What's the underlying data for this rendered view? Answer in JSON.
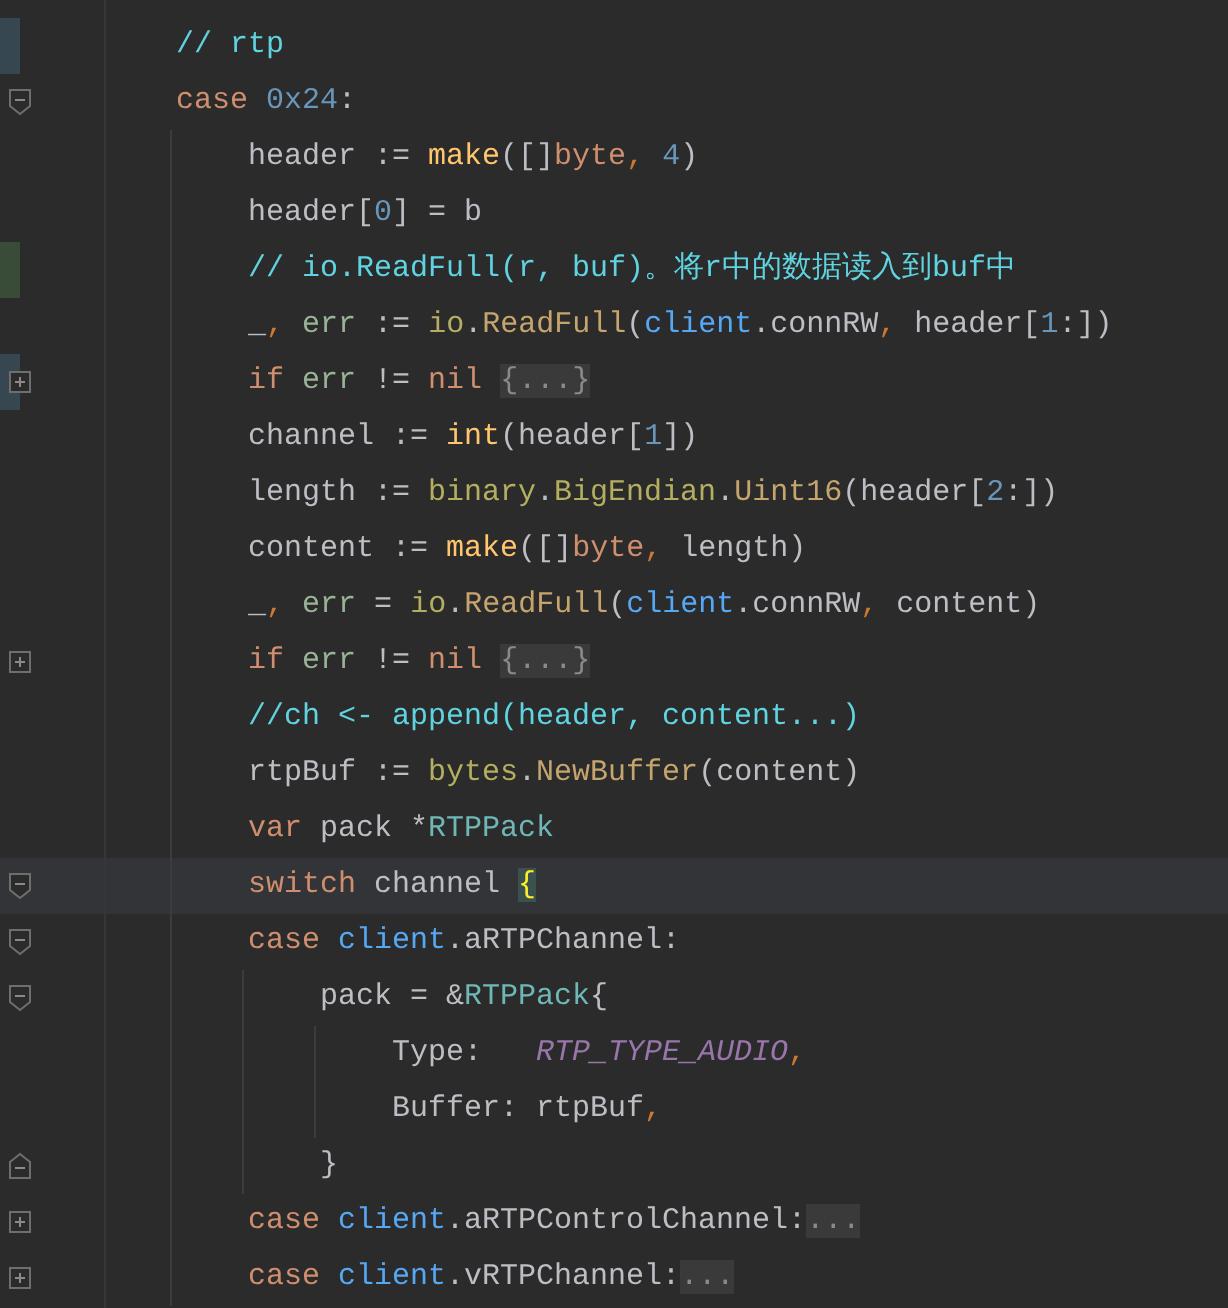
{
  "editor": {
    "lines": [
      {
        "color": "#374752",
        "kind": "plain",
        "current": false,
        "tokens": [
          {
            "text": "// rtp",
            "kind": "comment"
          }
        ]
      },
      {
        "kind": "fold_start",
        "current": false,
        "tokens": [
          {
            "text": "case ",
            "kind": "keyword"
          },
          {
            "text": "0x24",
            "kind": "number"
          },
          {
            "text": ":",
            "kind": "plain"
          }
        ],
        "children": [
          {
            "kind": "plain",
            "current": false,
            "tokens": [
              {
                "text": "header := ",
                "kind": "plain"
              },
              {
                "text": "make",
                "kind": "builtin"
              },
              {
                "text": "([]",
                "kind": "plain"
              },
              {
                "text": "byte",
                "kind": "keyword"
              },
              {
                "text": ", ",
                "kind": "punct"
              },
              {
                "text": "4",
                "kind": "number"
              },
              {
                "text": ")",
                "kind": "plain"
              }
            ]
          },
          {
            "kind": "plain",
            "current": false,
            "tokens": [
              {
                "text": "header[",
                "kind": "plain"
              },
              {
                "text": "0",
                "kind": "number"
              },
              {
                "text": "] = b",
                "kind": "plain"
              }
            ]
          },
          {
            "color": "#384c38",
            "kind": "plain",
            "current": false,
            "tokens": [
              {
                "text": "// io.ReadFull(r, buf)。将r中的数据读入到buf中",
                "kind": "comment"
              }
            ]
          },
          {
            "kind": "plain",
            "current": false,
            "tokens": [
              {
                "text": "_",
                "kind": "plain"
              },
              {
                "text": ", ",
                "kind": "punct"
              },
              {
                "text": "err",
                "kind": "local"
              },
              {
                "text": " := ",
                "kind": "plain"
              },
              {
                "text": "io",
                "kind": "package"
              },
              {
                "text": ".",
                "kind": "plain"
              },
              {
                "text": "ReadFull",
                "kind": "function"
              },
              {
                "text": "(",
                "kind": "plain"
              },
              {
                "text": "client",
                "kind": "field"
              },
              {
                "text": ".connRW",
                "kind": "plain"
              },
              {
                "text": ", ",
                "kind": "punct"
              },
              {
                "text": "header[",
                "kind": "plain"
              },
              {
                "text": "1",
                "kind": "number"
              },
              {
                "text": ":])",
                "kind": "plain"
              }
            ]
          },
          {
            "color": "#374752",
            "kind": "folded",
            "current": false,
            "tokens": [
              {
                "text": "if ",
                "kind": "keyword"
              },
              {
                "text": "err",
                "kind": "local"
              },
              {
                "text": " != ",
                "kind": "plain"
              },
              {
                "text": "nil ",
                "kind": "keyword"
              },
              {
                "text": "{...}",
                "kind": "folded"
              }
            ]
          },
          {
            "kind": "plain",
            "current": false,
            "tokens": [
              {
                "text": "channel := ",
                "kind": "plain"
              },
              {
                "text": "int",
                "kind": "builtin"
              },
              {
                "text": "(header[",
                "kind": "plain"
              },
              {
                "text": "1",
                "kind": "number"
              },
              {
                "text": "])",
                "kind": "plain"
              }
            ]
          },
          {
            "kind": "plain",
            "current": false,
            "tokens": [
              {
                "text": "length := ",
                "kind": "plain"
              },
              {
                "text": "binary",
                "kind": "package"
              },
              {
                "text": ".",
                "kind": "plain"
              },
              {
                "text": "BigEndian",
                "kind": "package"
              },
              {
                "text": ".",
                "kind": "plain"
              },
              {
                "text": "Uint16",
                "kind": "function"
              },
              {
                "text": "(header[",
                "kind": "plain"
              },
              {
                "text": "2",
                "kind": "number"
              },
              {
                "text": ":])",
                "kind": "plain"
              }
            ]
          },
          {
            "kind": "plain",
            "current": false,
            "tokens": [
              {
                "text": "content := ",
                "kind": "plain"
              },
              {
                "text": "make",
                "kind": "builtin"
              },
              {
                "text": "([]",
                "kind": "plain"
              },
              {
                "text": "byte",
                "kind": "keyword"
              },
              {
                "text": ", ",
                "kind": "punct"
              },
              {
                "text": "length)",
                "kind": "plain"
              }
            ]
          },
          {
            "kind": "plain",
            "current": false,
            "tokens": [
              {
                "text": "_",
                "kind": "plain"
              },
              {
                "text": ", ",
                "kind": "punct"
              },
              {
                "text": "err",
                "kind": "local"
              },
              {
                "text": " = ",
                "kind": "plain"
              },
              {
                "text": "io",
                "kind": "package"
              },
              {
                "text": ".",
                "kind": "plain"
              },
              {
                "text": "ReadFull",
                "kind": "function"
              },
              {
                "text": "(",
                "kind": "plain"
              },
              {
                "text": "client",
                "kind": "field"
              },
              {
                "text": ".connRW",
                "kind": "plain"
              },
              {
                "text": ", ",
                "kind": "punct"
              },
              {
                "text": "content)",
                "kind": "plain"
              }
            ]
          },
          {
            "kind": "folded",
            "current": false,
            "tokens": [
              {
                "text": "if ",
                "kind": "keyword"
              },
              {
                "text": "err",
                "kind": "local"
              },
              {
                "text": " != ",
                "kind": "plain"
              },
              {
                "text": "nil ",
                "kind": "keyword"
              },
              {
                "text": "{...}",
                "kind": "folded"
              }
            ]
          },
          {
            "kind": "plain",
            "current": false,
            "tokens": [
              {
                "text": "//ch <- append(header, content...)",
                "kind": "comment"
              }
            ]
          },
          {
            "kind": "plain",
            "current": false,
            "tokens": [
              {
                "text": "rtpBuf := ",
                "kind": "plain"
              },
              {
                "text": "bytes",
                "kind": "package"
              },
              {
                "text": ".",
                "kind": "plain"
              },
              {
                "text": "NewBuffer",
                "kind": "function"
              },
              {
                "text": "(content)",
                "kind": "plain"
              }
            ]
          },
          {
            "kind": "plain",
            "current": false,
            "tokens": [
              {
                "text": "var ",
                "kind": "keyword"
              },
              {
                "text": "pack *",
                "kind": "plain"
              },
              {
                "text": "RTPPack",
                "kind": "type"
              }
            ]
          },
          {
            "kind": "fold_start",
            "current": true,
            "tokens": [
              {
                "text": "switch ",
                "kind": "keyword"
              },
              {
                "text": "channel ",
                "kind": "plain"
              },
              {
                "text": "{",
                "kind": "brace_match"
              }
            ]
          },
          {
            "kind": "fold_start",
            "current": false,
            "tokens": [
              {
                "text": "case ",
                "kind": "keyword"
              },
              {
                "text": "client",
                "kind": "field"
              },
              {
                "text": ".aRTPChannel:",
                "kind": "plain"
              }
            ],
            "children": [
              {
                "kind": "fold_start",
                "current": false,
                "tokens": [
                  {
                    "text": "pack = &",
                    "kind": "plain"
                  },
                  {
                    "text": "RTPPack",
                    "kind": "type"
                  },
                  {
                    "text": "{",
                    "kind": "plain"
                  }
                ],
                "children": [
                  {
                    "current": false,
                    "tokens": [
                      {
                        "text": "Type:   ",
                        "kind": "plain"
                      },
                      {
                        "text": "RTP_TYPE_AUDIO",
                        "kind": "constant"
                      },
                      {
                        "text": ",",
                        "kind": "punct"
                      }
                    ]
                  },
                  {
                    "current": false,
                    "tokens": [
                      {
                        "text": "Buffer: rtpBuf",
                        "kind": "plain"
                      },
                      {
                        "text": ",",
                        "kind": "punct"
                      }
                    ]
                  }
                ]
              },
              {
                "kind": "fold_end",
                "current": false,
                "tokens": [
                  {
                    "text": "}",
                    "kind": "plain"
                  }
                ]
              }
            ]
          },
          {
            "kind": "folded",
            "current": false,
            "tokens": [
              {
                "text": "case ",
                "kind": "keyword"
              },
              {
                "text": "client",
                "kind": "field"
              },
              {
                "text": ".aRTPControlChannel:",
                "kind": "plain"
              },
              {
                "text": "...",
                "kind": "folded"
              }
            ]
          },
          {
            "kind": "folded",
            "current": false,
            "tokens": [
              {
                "text": "case ",
                "kind": "keyword"
              },
              {
                "text": "client",
                "kind": "field"
              },
              {
                "text": ".vRTPChannel:",
                "kind": "plain"
              },
              {
                "text": "...",
                "kind": "folded"
              }
            ]
          }
        ]
      }
    ]
  }
}
